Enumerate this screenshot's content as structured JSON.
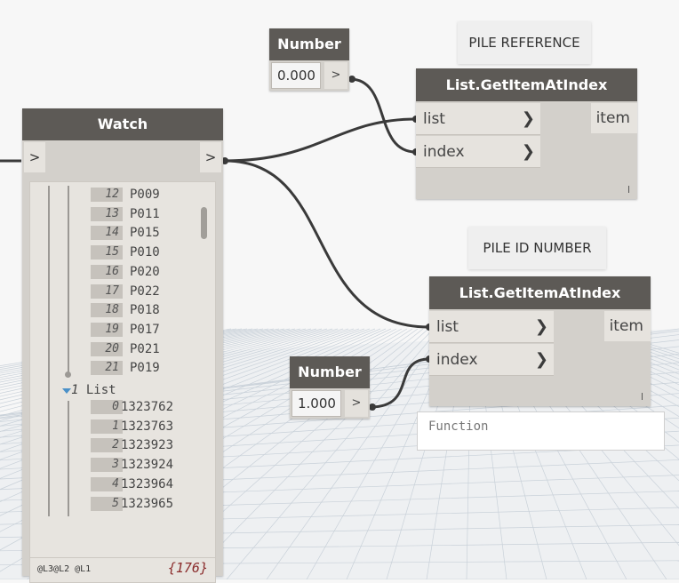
{
  "number_node_top": {
    "title": "Number",
    "value": "0.000",
    "output": ">"
  },
  "number_node_bottom": {
    "title": "Number",
    "value": "1.000",
    "output": ">"
  },
  "note_pile_reference": "PILE REFERENCE",
  "note_pile_id_number": "PILE ID NUMBER",
  "get_item_top": {
    "title": "List.GetItemAtIndex",
    "input_list": "list",
    "input_index": "index",
    "output": "item",
    "lacing": "l"
  },
  "get_item_bottom": {
    "title": "List.GetItemAtIndex",
    "input_list": "list",
    "input_index": "index",
    "output": "item",
    "lacing": "l"
  },
  "function_box": "Function",
  "watch": {
    "title": "Watch",
    "input": ">",
    "output": ">",
    "sublist_index": "1",
    "sublist_label": "List",
    "items_list0": [
      {
        "index": "12",
        "value": "P009"
      },
      {
        "index": "13",
        "value": "P011"
      },
      {
        "index": "14",
        "value": "P015"
      },
      {
        "index": "15",
        "value": "P010"
      },
      {
        "index": "16",
        "value": "P020"
      },
      {
        "index": "17",
        "value": "P022"
      },
      {
        "index": "18",
        "value": "P018"
      },
      {
        "index": "19",
        "value": "P017"
      },
      {
        "index": "20",
        "value": "P021"
      },
      {
        "index": "21",
        "value": "P019"
      }
    ],
    "items_list1": [
      {
        "index": "0",
        "value": "1323762"
      },
      {
        "index": "1",
        "value": "1323763"
      },
      {
        "index": "2",
        "value": "1323923"
      },
      {
        "index": "3",
        "value": "1323924"
      },
      {
        "index": "4",
        "value": "1323964"
      },
      {
        "index": "5",
        "value": "1323965"
      }
    ],
    "levels": "@L3@L2 @L1",
    "count": "{176}"
  },
  "colors": {
    "header": "#5d5a56",
    "body": "#d3d0cb",
    "wire": "#3a3a3a",
    "count": "#8a2b2b"
  }
}
